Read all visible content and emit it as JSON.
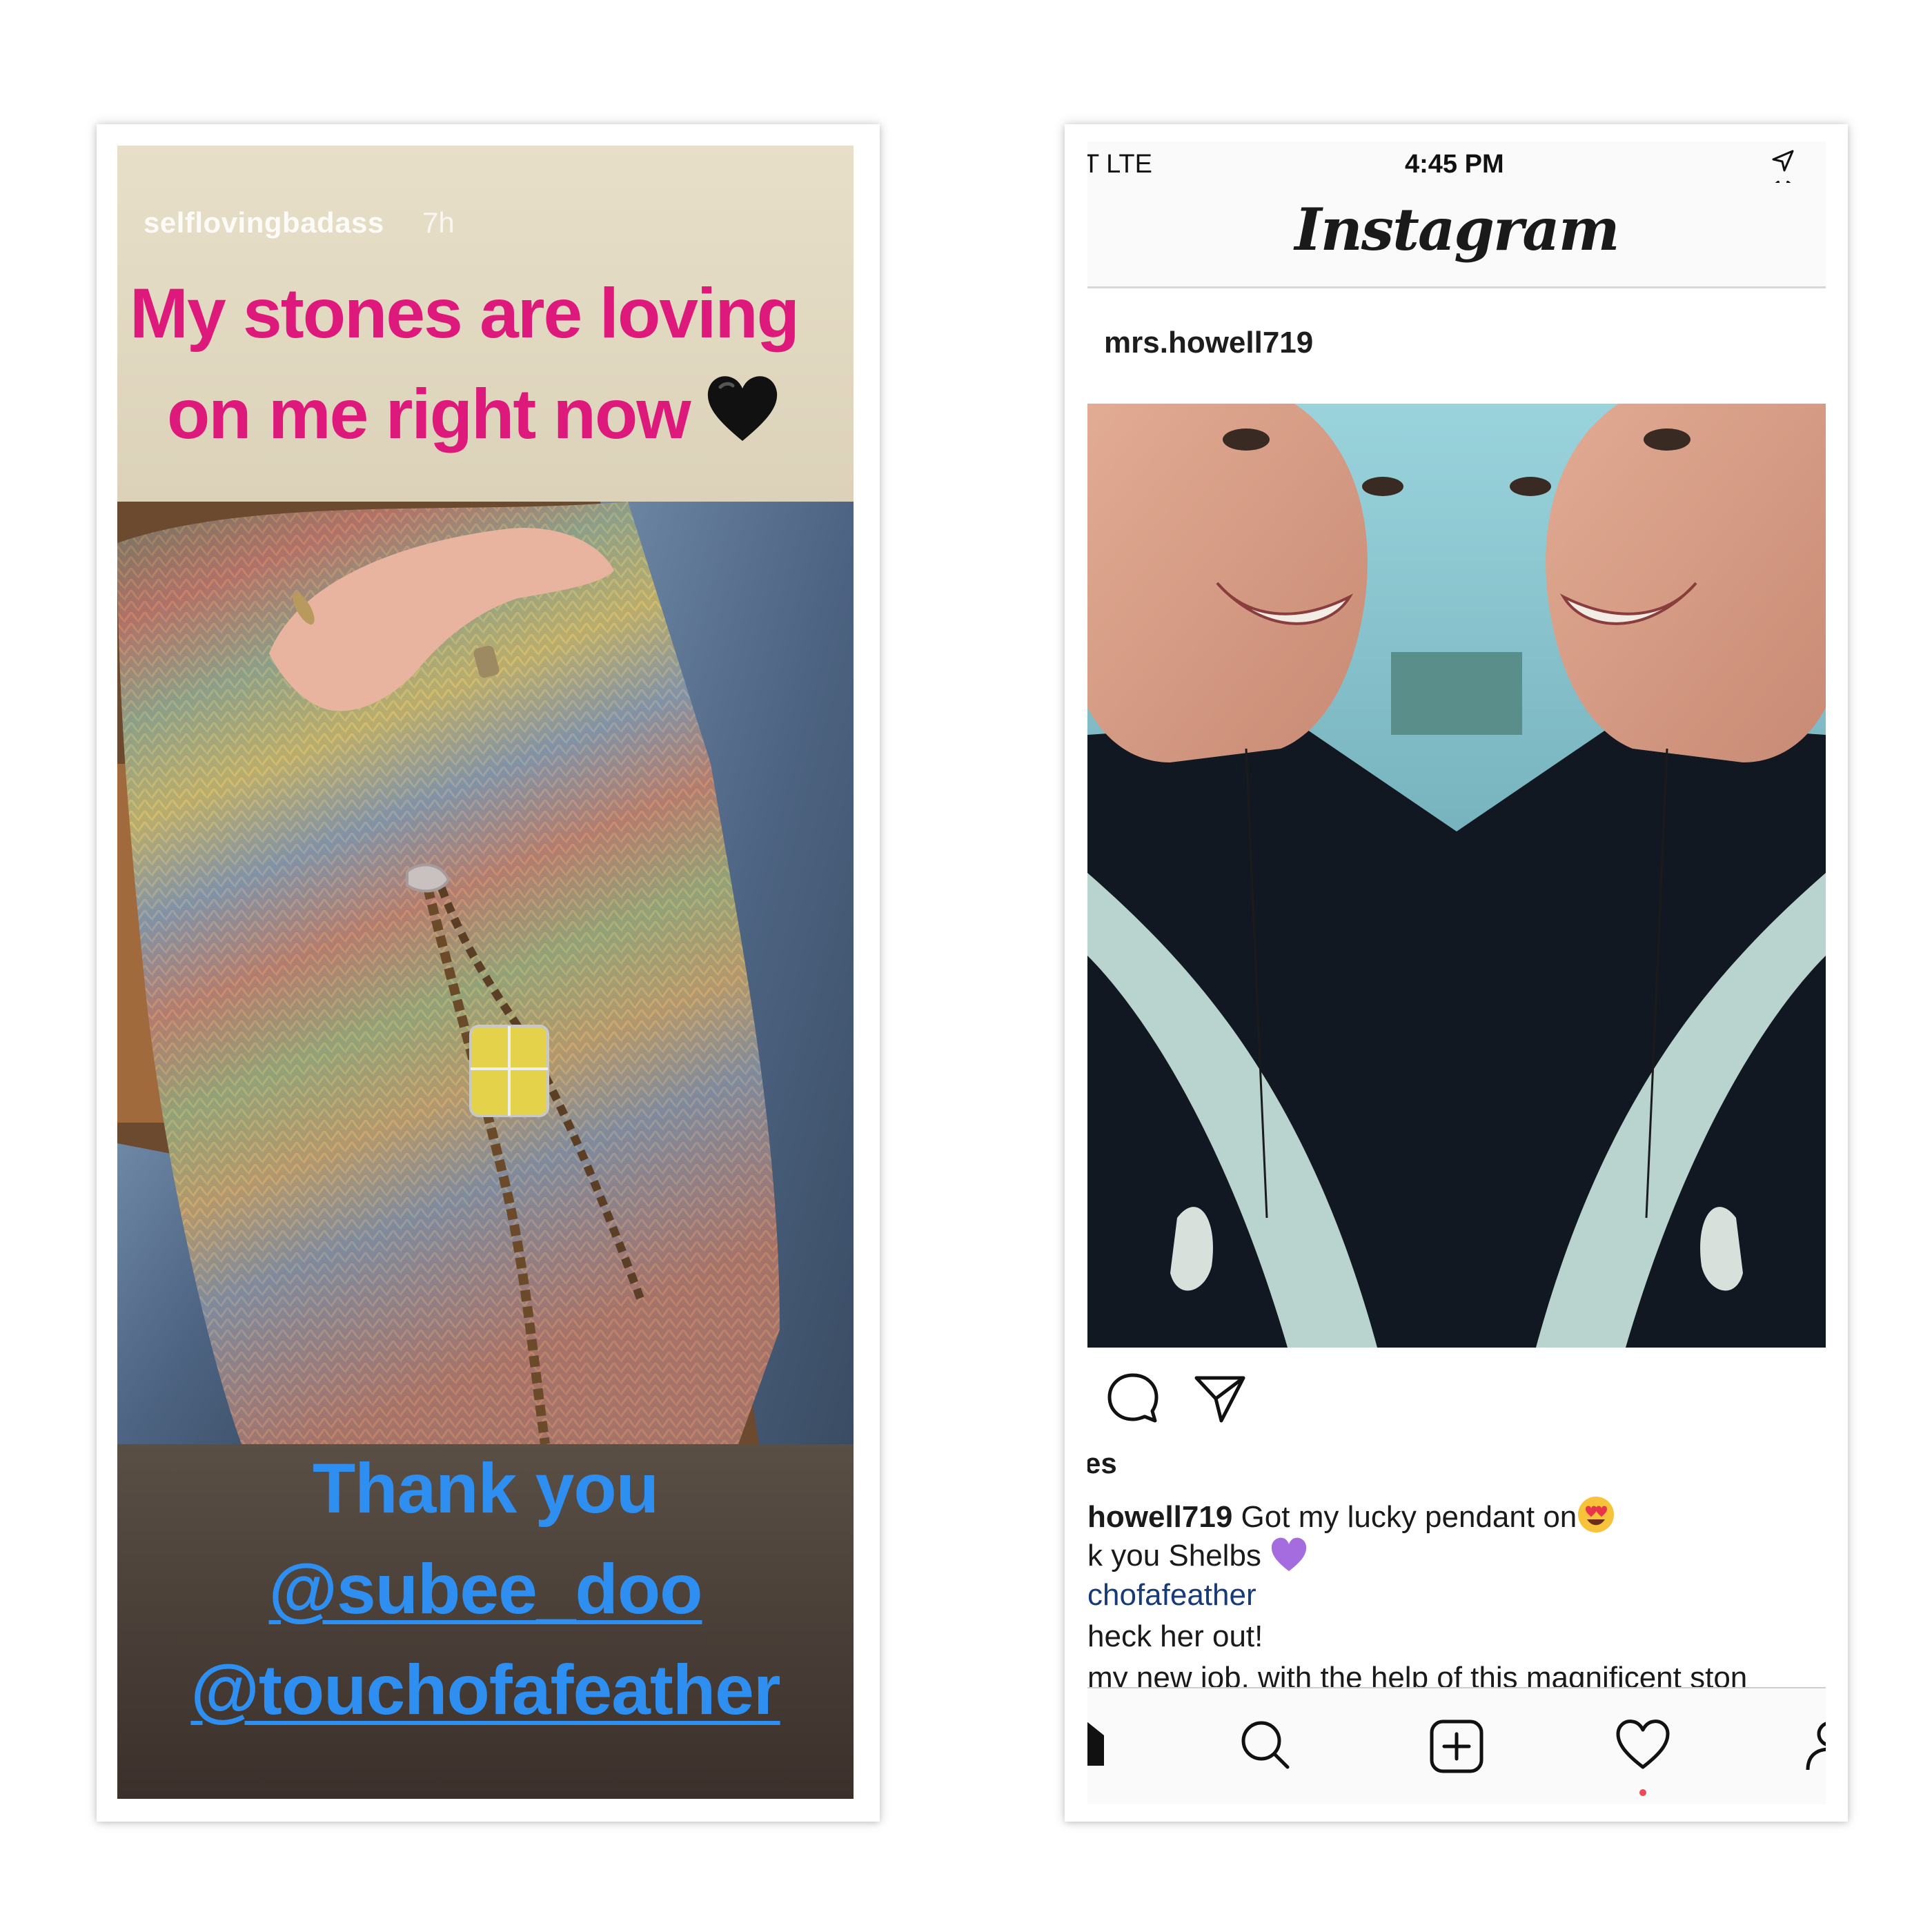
{
  "story": {
    "username": "selflovingbadass",
    "age": "7h",
    "caption_line1": "My stones are loving",
    "caption_line2": "on me right now",
    "emoji_heart": "black-heart",
    "thanks": "Thank you",
    "mention1": "@subee_doo",
    "mention2": "@touchofafeather"
  },
  "instagram": {
    "status": {
      "carrier": "T  LTE",
      "time": "4:45 PM",
      "icons": [
        "location-arrow-icon",
        "alarm-icon"
      ]
    },
    "logo": "Instagram",
    "post_user": "mrs.howell719",
    "actions": [
      "comment-icon",
      "share-icon"
    ],
    "likes_fragment": "es",
    "caption": {
      "user": "howell719",
      "line1": "Got my lucky pendant on",
      "line2": "k you Shelbs",
      "line3": "chofafeather",
      "line4": "heck her out!",
      "line5": " my new job, with the help of this magnificent ston"
    },
    "tabs": [
      "home-icon",
      "search-icon",
      "new-post-icon",
      "activity-heart-icon",
      "profile-icon"
    ],
    "colors": {
      "link": "#173a78",
      "notification": "#ed4956"
    }
  },
  "colors": {
    "story_caption": "#dd1a7b",
    "story_thanks": "#2e8ff0"
  }
}
